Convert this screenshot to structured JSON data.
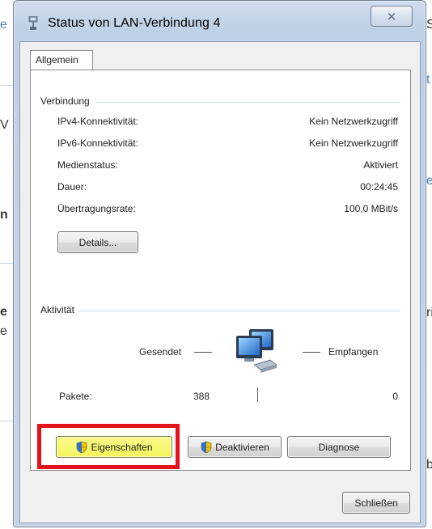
{
  "window": {
    "title": "Status von LAN-Verbindung 4",
    "close_symbol": "⨯"
  },
  "tabs": [
    {
      "label": "Allgemein",
      "selected": true
    }
  ],
  "connection": {
    "group_label": "Verbindung",
    "rows": [
      {
        "label": "IPv4-Konnektivität:",
        "value": "Kein Netzwerkzugriff"
      },
      {
        "label": "IPv6-Konnektivität:",
        "value": "Kein Netzwerkzugriff"
      },
      {
        "label": "Medienstatus:",
        "value": "Aktiviert"
      },
      {
        "label": "Dauer:",
        "value": "00:24:45"
      },
      {
        "label": "Übertragungsrate:",
        "value": "100,0 MBit/s"
      }
    ],
    "details_button": "Details..."
  },
  "activity": {
    "group_label": "Aktivität",
    "sent_label": "Gesendet",
    "received_label": "Empfangen",
    "packets_label": "Pakete:",
    "packets_sent": "388",
    "packets_received": "0"
  },
  "buttons": {
    "properties": "Eigenschaften",
    "deactivate": "Deaktivieren",
    "diagnose": "Diagnose",
    "close": "Schließen"
  },
  "colors": {
    "highlight_box": "#e3131b",
    "highlight_fill": "#f3f35c"
  }
}
